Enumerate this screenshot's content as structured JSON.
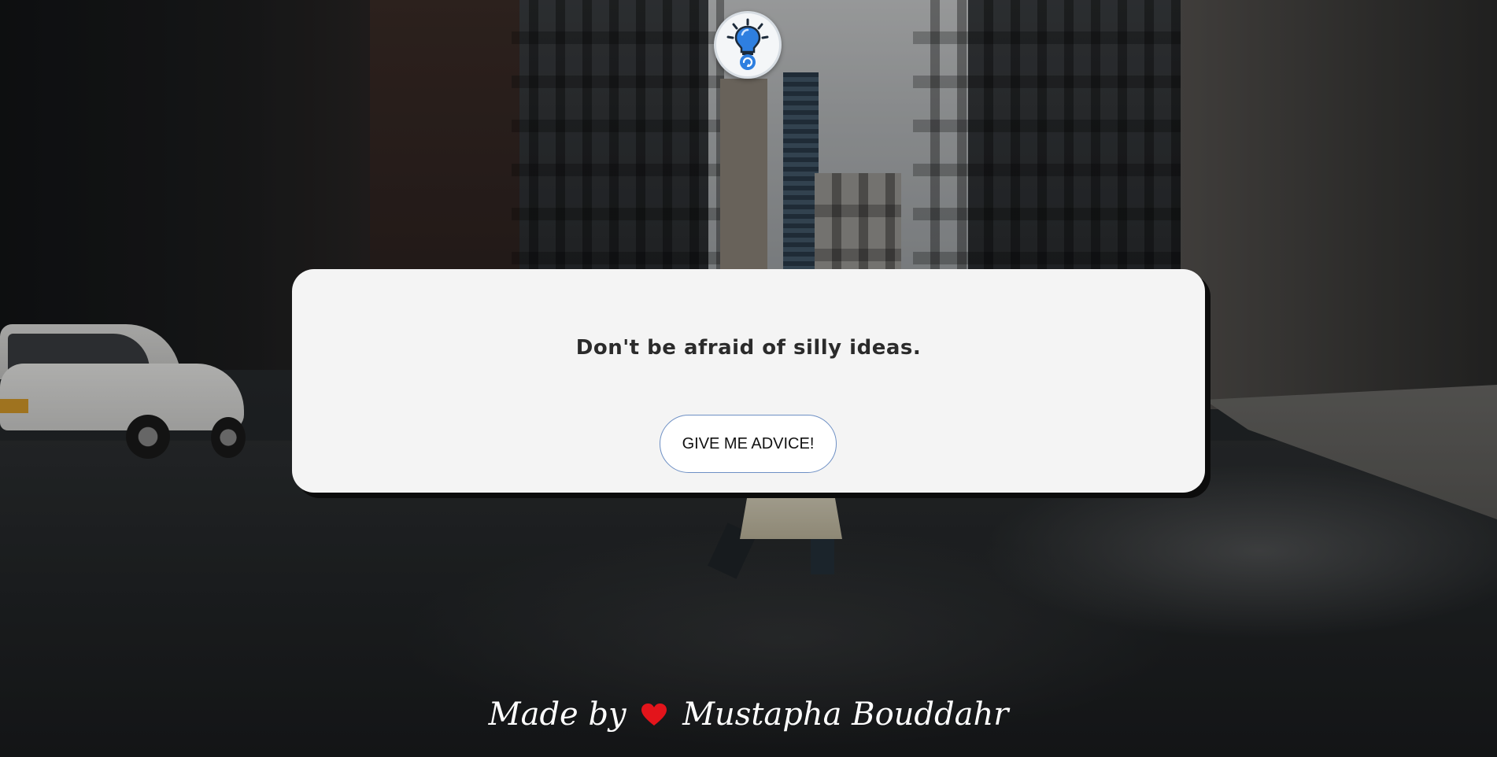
{
  "app": {
    "logo_icon": "lightbulb-refresh-icon"
  },
  "card": {
    "advice": "Don't be afraid of silly ideas.",
    "button_label": "GIVE ME ADVICE!"
  },
  "footer": {
    "prefix": "Made by",
    "heart_icon": "heart-icon",
    "heart_color": "#e3141b",
    "author": "Mustapha Bouddahr"
  },
  "colors": {
    "card_background": "#f4f4f4",
    "card_shadow": "#0c0c0c",
    "button_border": "#6d8fc4",
    "logo_accent": "#2e7fe0"
  }
}
